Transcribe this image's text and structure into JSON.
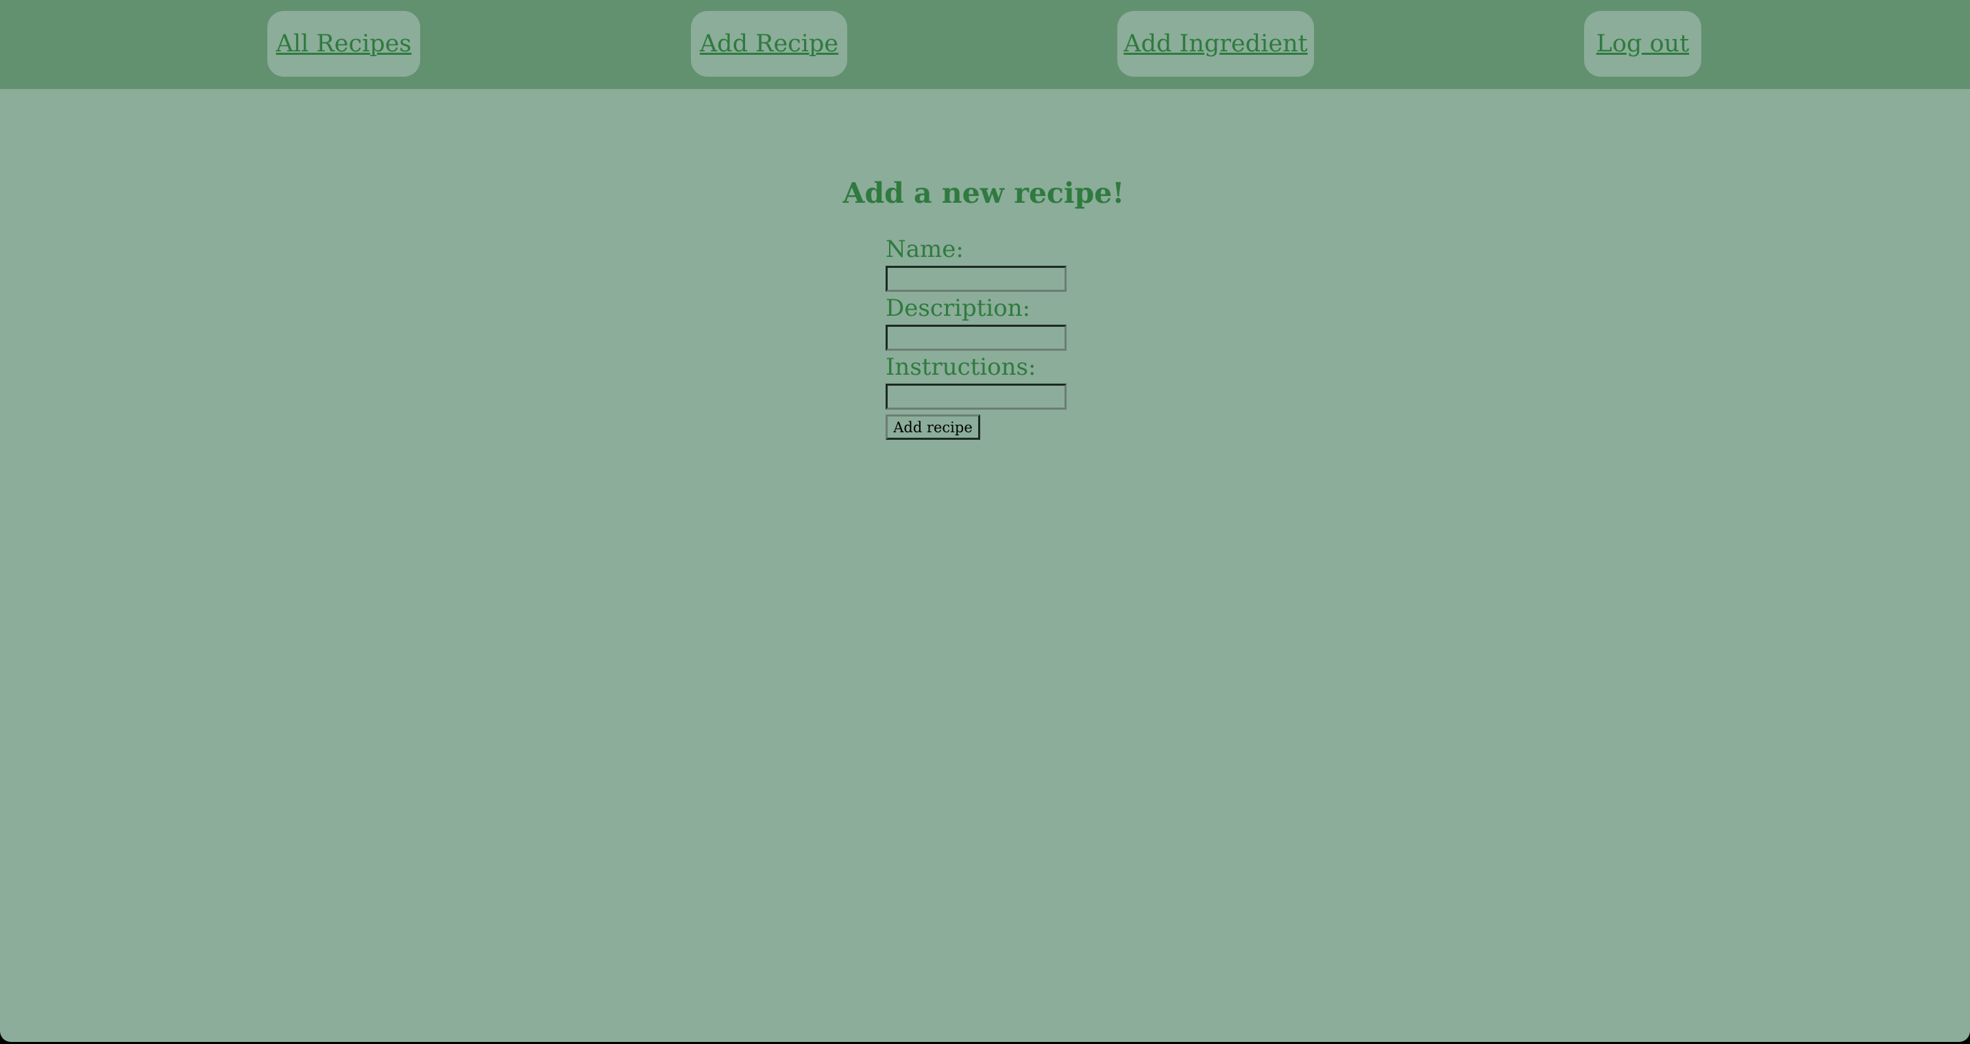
{
  "nav": {
    "all_recipes": "All Recipes",
    "add_recipe": "Add Recipe",
    "add_ingredient": "Add Ingredient",
    "log_out": "Log out"
  },
  "page": {
    "title": "Add a new recipe!"
  },
  "form": {
    "name_label": "Name:",
    "name_value": "",
    "description_label": "Description:",
    "description_value": "",
    "instructions_label": "Instructions:",
    "instructions_value": "",
    "submit_label": "Add recipe"
  },
  "colors": {
    "navbar_bg": "#629170",
    "page_bg": "#8bad99",
    "text_green": "#2f7a3f"
  }
}
